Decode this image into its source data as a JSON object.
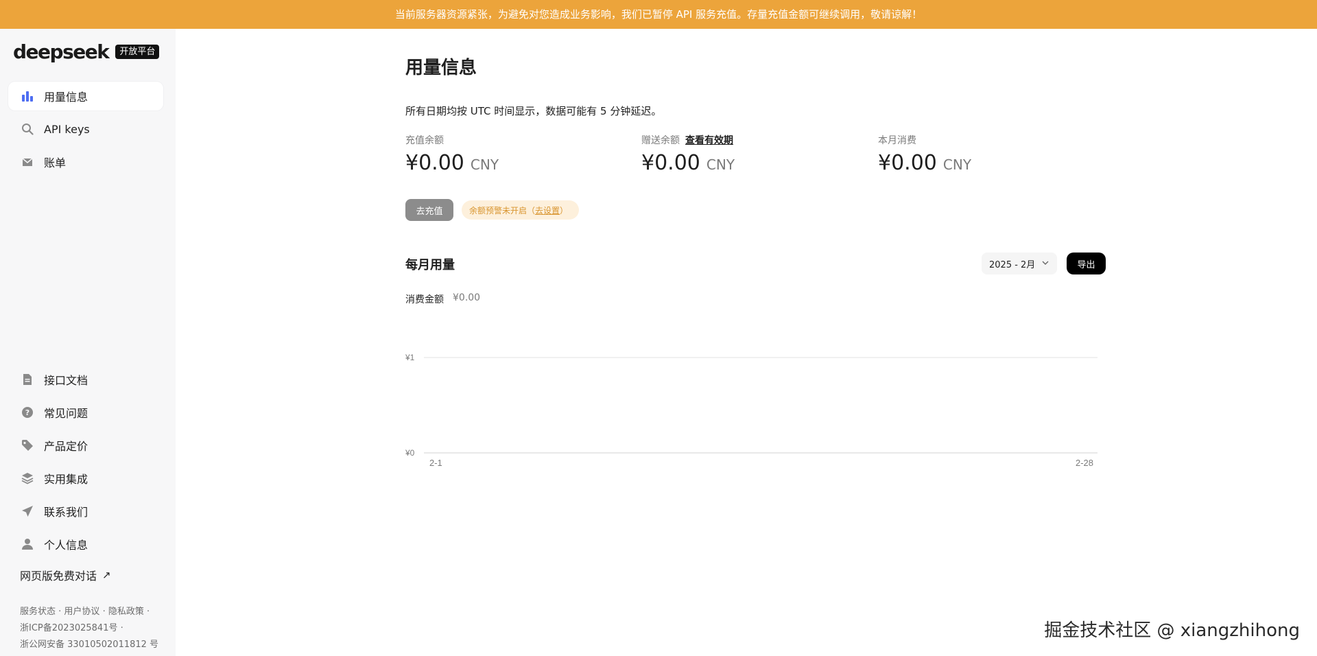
{
  "banner": {
    "text": "当前服务器资源紧张，为避免对您造成业务影响，我们已暂停 API 服务充值。存量充值金额可继续调用，敬请谅解！"
  },
  "sidebar": {
    "logo_text": "deepseek",
    "logo_badge": "开放平台",
    "top_items": [
      {
        "label": "用量信息",
        "icon": "bar-chart-icon",
        "active": true
      },
      {
        "label": "API keys",
        "icon": "key-search-icon"
      },
      {
        "label": "账单",
        "icon": "inbox-icon"
      }
    ],
    "bottom_items": [
      {
        "label": "接口文档",
        "icon": "document-icon"
      },
      {
        "label": "常见问题",
        "icon": "question-circle-icon"
      },
      {
        "label": "产品定价",
        "icon": "tag-icon"
      },
      {
        "label": "实用集成",
        "icon": "layers-icon"
      },
      {
        "label": "联系我们",
        "icon": "send-icon"
      },
      {
        "label": "个人信息",
        "icon": "user-icon"
      }
    ],
    "web_chat": {
      "label": "网页版免费对话",
      "arrow": "↗"
    },
    "footer": {
      "status": "服务状态",
      "agreement": "用户协议",
      "privacy": "隐私政策",
      "sep": " · ",
      "icp": "浙ICP备2023025841号 ·",
      "police": "浙公网安备 33010502011812 号"
    }
  },
  "main": {
    "title": "用量信息",
    "notice": "所有日期均按 UTC 时间显示，数据可能有 5 分钟延迟。",
    "stats": [
      {
        "label": "充值余额",
        "amount": "¥0.00",
        "currency": "CNY",
        "link": ""
      },
      {
        "label": "赠送余额",
        "amount": "¥0.00",
        "currency": "CNY",
        "link": "查看有效期"
      },
      {
        "label": "本月消费",
        "amount": "¥0.00",
        "currency": "CNY",
        "link": ""
      }
    ],
    "recharge_button": "去充值",
    "alert": {
      "text": "余额预警未开启（",
      "link": "去设置",
      "end": "）"
    },
    "monthly": {
      "title": "每月用量",
      "selected_month": "2025 - 2月",
      "export_button": "导出",
      "spend_label": "消费金额",
      "spend_value": "¥0.00"
    }
  },
  "chart_data": {
    "type": "line",
    "x": [
      "2-1",
      "2-28"
    ],
    "xtick_labels": [
      "2-1",
      "2-28"
    ],
    "ytick_labels": [
      "¥1",
      "¥0"
    ],
    "ylim": [
      0,
      1
    ],
    "series": [
      {
        "values": [
          0,
          0
        ]
      }
    ],
    "grid": true,
    "colors": {
      "grid": "#e8e8e8",
      "axis": "#d9d9d9",
      "line": "#4e6ef2"
    }
  },
  "watermark": "掘金技术社区 @ xiangzhihong",
  "colors": {
    "banner": "#eca43b",
    "accent": "#4e6ef2",
    "sidebar_bg": "#f7f7f8"
  }
}
